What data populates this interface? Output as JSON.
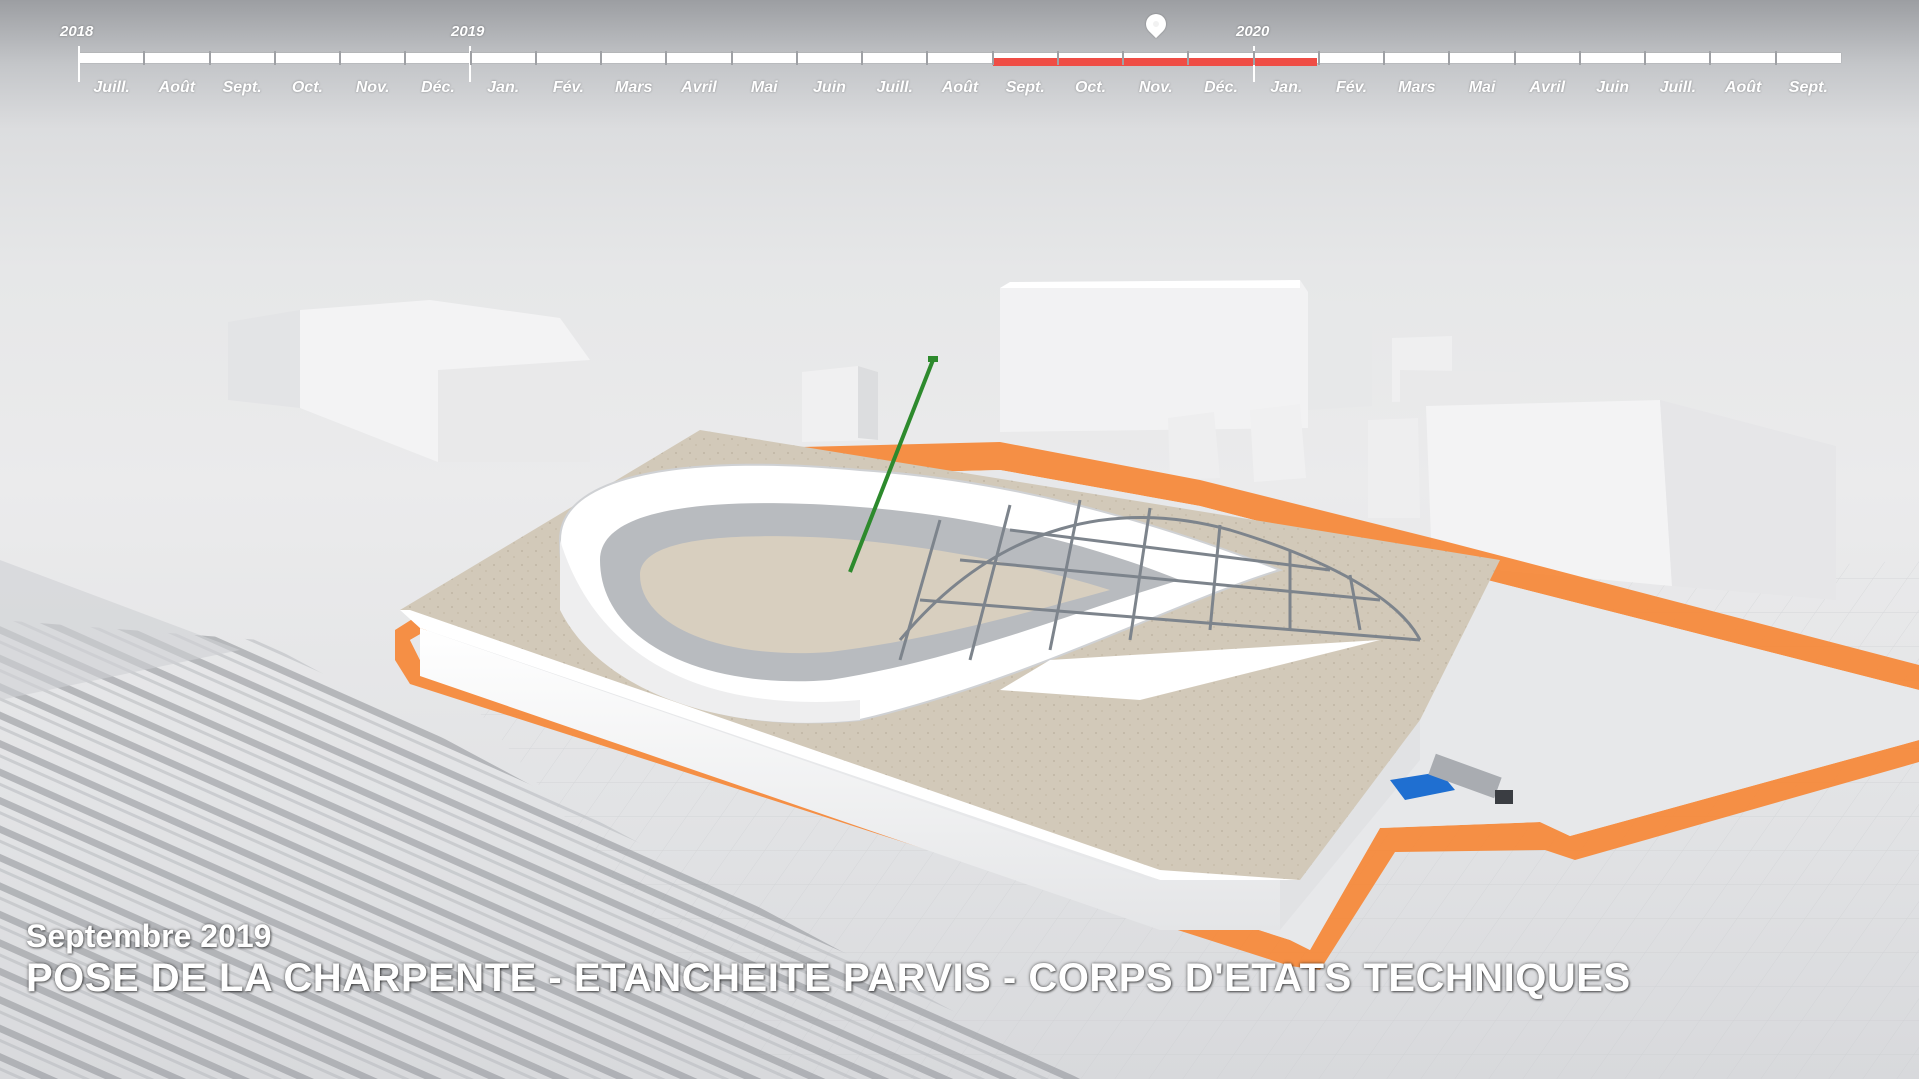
{
  "timeline": {
    "years": [
      {
        "label": "2018"
      },
      {
        "label": "2019"
      },
      {
        "label": "2020"
      }
    ],
    "months": [
      "Juill.",
      "Août",
      "Sept.",
      "Oct.",
      "Nov.",
      "Déc.",
      "Jan.",
      "Fév.",
      "Mars",
      "Avril",
      "Mai",
      "Juin",
      "Juill.",
      "Août",
      "Sept.",
      "Oct.",
      "Nov.",
      "Déc.",
      "Jan.",
      "Fév.",
      "Mars",
      "Mai",
      "Avril",
      "Juin",
      "Juill.",
      "Août",
      "Sept."
    ],
    "progress_start_month_index": 14,
    "progress_end_month_index": 18,
    "current_marker_month_index": 16,
    "colors": {
      "track": "#ffffff",
      "progress": "#ef4d45",
      "label": "#ffffff"
    },
    "icons": {
      "marker": "map-pin-icon"
    }
  },
  "scene": {
    "colors": {
      "site_border": "#f58a3c",
      "building": "#f4f4f4",
      "roof": "#cdc3b3",
      "crane": "#2d8a2d",
      "steel": "#8e949c"
    }
  },
  "caption": {
    "date": "Septembre 2019",
    "title": "POSE DE LA CHARPENTE - ETANCHEITE PARVIS - CORPS D'ETATS TECHNIQUES"
  }
}
